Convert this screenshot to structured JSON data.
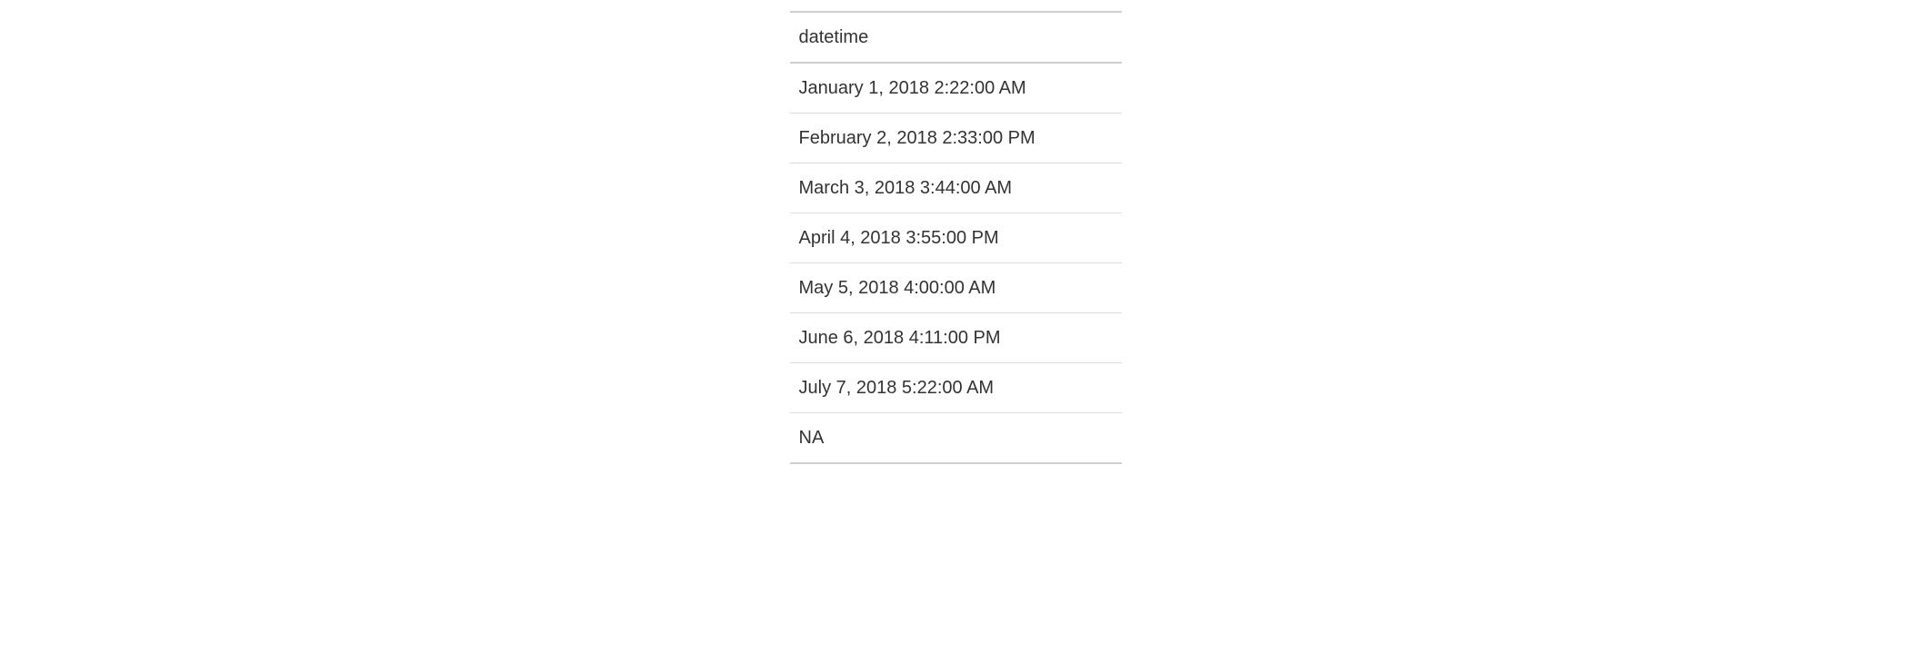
{
  "table": {
    "header": "datetime",
    "rows": [
      "January 1, 2018 2:22:00 AM",
      "February 2, 2018 2:33:00 PM",
      "March 3, 2018 3:44:00 AM",
      "April 4, 2018 3:55:00 PM",
      "May 5, 2018 4:00:00 AM",
      "June 6, 2018 4:11:00 PM",
      "July 7, 2018 5:22:00 AM",
      "NA"
    ]
  }
}
